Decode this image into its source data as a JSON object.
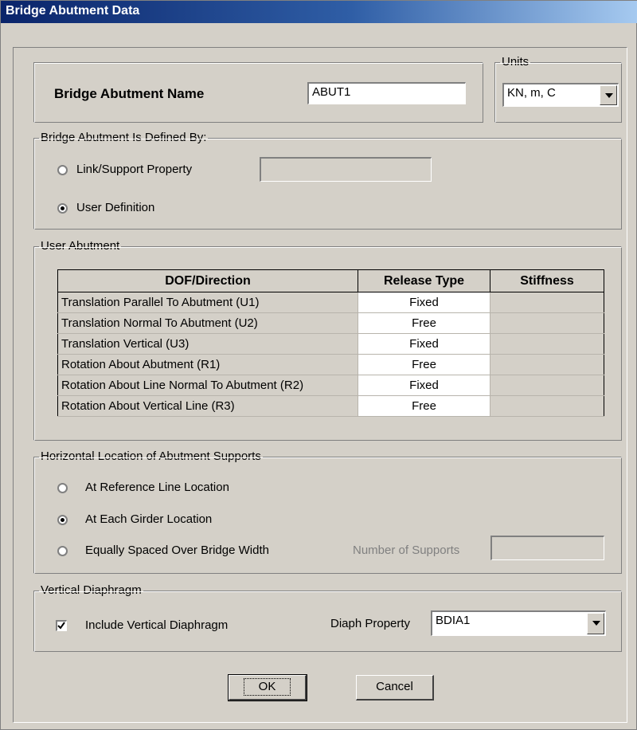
{
  "window": {
    "title": "Bridge Abutment Data"
  },
  "name_group": {
    "label": "Bridge Abutment Name",
    "value": "ABUT1"
  },
  "units": {
    "legend": "Units",
    "selected": "KN, m, C"
  },
  "defined_by": {
    "legend": "Bridge Abutment Is Defined By:",
    "options": [
      {
        "label": "Link/Support Property",
        "selected": false
      },
      {
        "label": "User Definition",
        "selected": true
      }
    ],
    "link_property_value": ""
  },
  "user_abutment": {
    "legend": "User Abutment",
    "columns": [
      "DOF/Direction",
      "Release Type",
      "Stiffness"
    ],
    "rows": [
      {
        "dof": "Translation Parallel To Abutment (U1)",
        "release": "Fixed",
        "stiffness": ""
      },
      {
        "dof": "Translation Normal To Abutment (U2)",
        "release": "Free",
        "stiffness": ""
      },
      {
        "dof": "Translation Vertical (U3)",
        "release": "Fixed",
        "stiffness": ""
      },
      {
        "dof": "Rotation About Abutment (R1)",
        "release": "Free",
        "stiffness": ""
      },
      {
        "dof": "Rotation About Line Normal To Abutment (R2)",
        "release": "Fixed",
        "stiffness": ""
      },
      {
        "dof": "Rotation About Vertical Line (R3)",
        "release": "Free",
        "stiffness": ""
      }
    ]
  },
  "horizontal_location": {
    "legend": "Horizontal Location of Abutment Supports",
    "options": [
      {
        "label": "At Reference Line Location",
        "selected": false
      },
      {
        "label": "At Each Girder Location",
        "selected": true
      },
      {
        "label": "Equally Spaced Over Bridge Width",
        "selected": false
      }
    ],
    "num_supports_label": "Number of Supports",
    "num_supports_value": ""
  },
  "vertical_diaphragm": {
    "legend": "Vertical Diaphragm",
    "include_label": "Include Vertical Diaphragm",
    "include_checked": true,
    "property_label": "Diaph Property",
    "property_value": "BDIA1"
  },
  "buttons": {
    "ok": "OK",
    "cancel": "Cancel"
  }
}
